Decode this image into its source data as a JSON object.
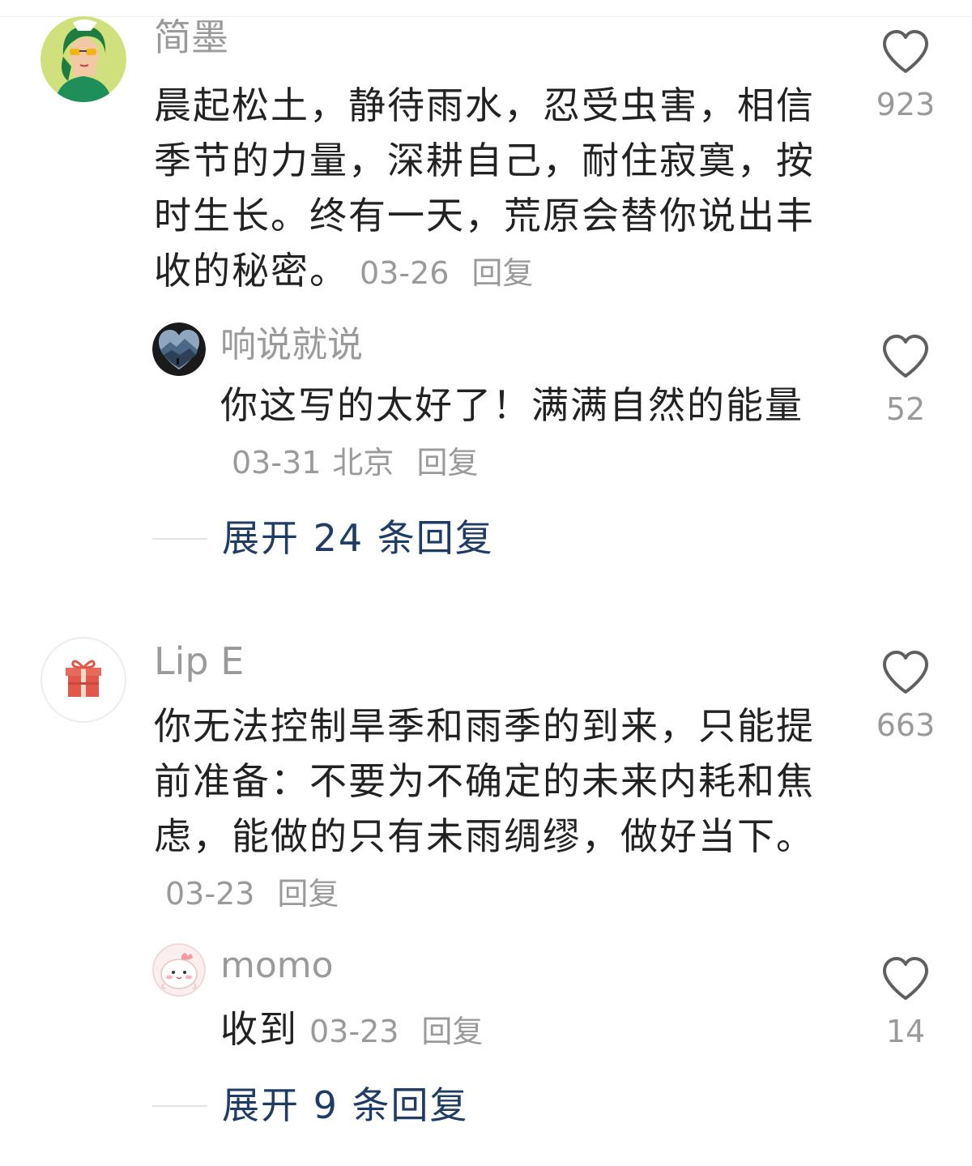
{
  "comments": [
    {
      "username": "简墨",
      "text": "晨起松土，静待雨水，忍受虫害，相信季节的力量，深耕自己，耐住寂寞，按时生长。终有一天，荒原会替你说出丰收的秘密。",
      "date": "03-26",
      "location": "",
      "reply_label": "回复",
      "likes": "923",
      "avatar_icon": "avatar-girl-green-hair-icon",
      "replies": [
        {
          "username": "响说就说",
          "text": "你这写的太好了！满满自然的能量",
          "date": "03-31",
          "location": "北京",
          "reply_label": "回复",
          "likes": "52",
          "avatar_icon": "avatar-mountain-heart-icon"
        }
      ],
      "expand_label": "展开 24 条回复"
    },
    {
      "username": "Lip E",
      "text": "你无法控制旱季和雨季的到来，只能提前准备：不要为不确定的未来内耗和焦虑，能做的只有未雨绸缪，做好当下。",
      "date": "03-23",
      "location": "",
      "reply_label": "回复",
      "likes": "663",
      "avatar_icon": "avatar-gift-icon",
      "replies": [
        {
          "username": "momo",
          "text": "收到",
          "date": "03-23",
          "location": "",
          "reply_label": "回复",
          "likes": "14",
          "avatar_icon": "avatar-cute-pink-creature-icon"
        }
      ],
      "expand_label": "展开 9 条回复"
    }
  ],
  "colors": {
    "text": "#222222",
    "meta": "#9a9a9a",
    "expand": "#1f3d64",
    "heart": "#5f5f5f"
  }
}
